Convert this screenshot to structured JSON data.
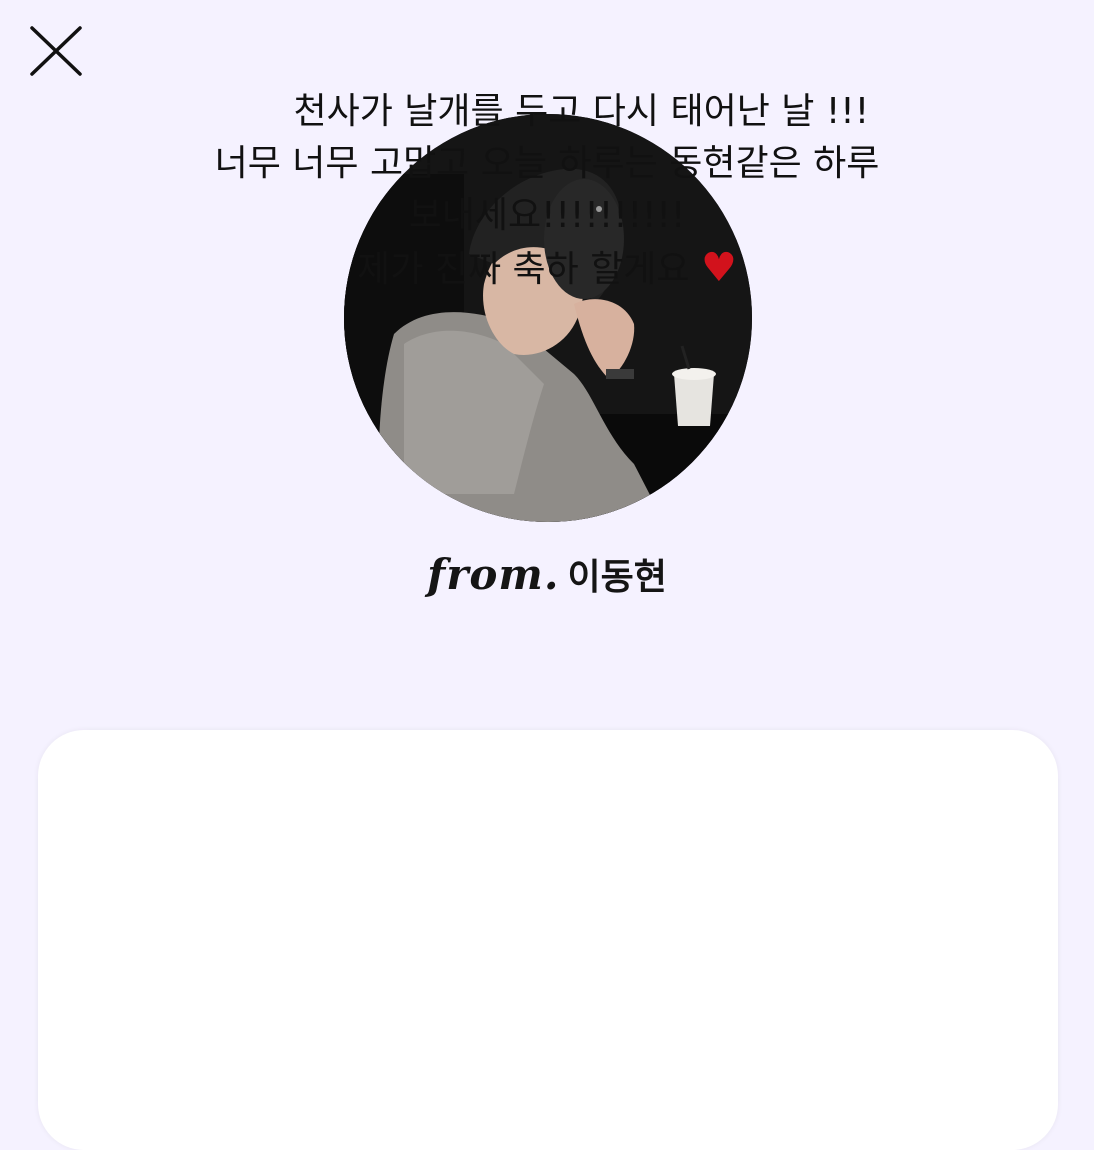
{
  "message": {
    "lines": [
      "      천사가 날개를 두고 다시 태어난 날 !!!",
      "너무 너무 고맙고 오늘 하루는 동현같은 하루",
      "보내세요!!!!!!!!!!",
      "제가 진짜 축하 할게요 "
    ],
    "heart": "♥"
  },
  "sender": {
    "prefix": "from.",
    "name": "이동현"
  },
  "colors": {
    "background": "#f5f2ff",
    "card": "#ffffff",
    "heart": "#d2121c",
    "text": "#111111"
  },
  "icons": {
    "close": "close-icon",
    "heart": "heart-icon"
  }
}
